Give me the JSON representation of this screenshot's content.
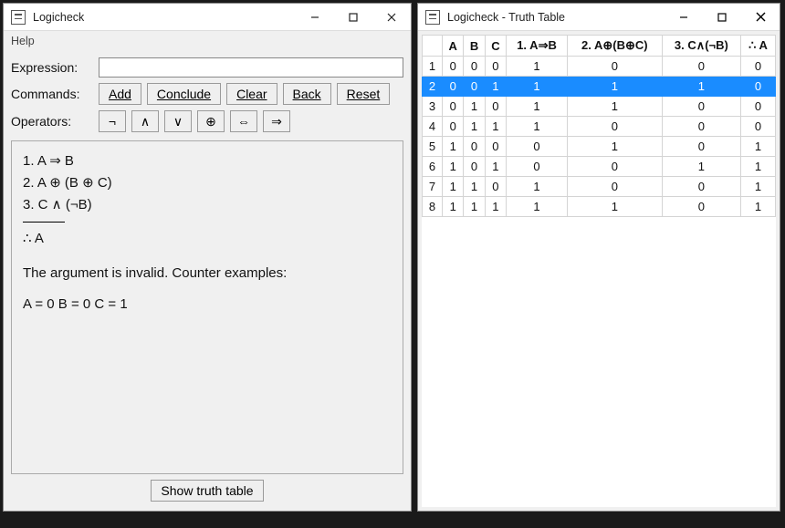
{
  "leftWindow": {
    "title": "Logicheck",
    "menu": {
      "help": "Help"
    },
    "labels": {
      "expression": "Expression:",
      "commands": "Commands:",
      "operators": "Operators:"
    },
    "expressionValue": "",
    "commands": {
      "add": "Add",
      "conclude": "Conclude",
      "clear": "Clear",
      "back": "Back",
      "reset": "Reset"
    },
    "operators": {
      "not": "¬",
      "and": "∧",
      "or": "∨",
      "xor": "⊕",
      "iff": "⇔",
      "implies": "⇒"
    },
    "output": {
      "line1": "1. A ⇒ B",
      "line2": "2. A ⊕ (B ⊕ C)",
      "line3": "3. C ∧ (¬B)",
      "therefore": "∴  A",
      "verdict": "The argument is invalid. Counter examples:",
      "counter": "A = 0  B = 0  C = 1"
    },
    "showTruthTable": "Show truth table"
  },
  "rightWindow": {
    "title": "Logicheck - Truth Table",
    "table": {
      "headers": [
        "A",
        "B",
        "C",
        "1.  A⇒B",
        "2.  A⊕(B⊕C)",
        "3.  C∧(¬B)",
        "∴  A"
      ],
      "rows": [
        {
          "n": 1,
          "cells": [
            "0",
            "0",
            "0",
            "1",
            "0",
            "0",
            "0"
          ],
          "selected": false
        },
        {
          "n": 2,
          "cells": [
            "0",
            "0",
            "1",
            "1",
            "1",
            "1",
            "0"
          ],
          "selected": true
        },
        {
          "n": 3,
          "cells": [
            "0",
            "1",
            "0",
            "1",
            "1",
            "0",
            "0"
          ],
          "selected": false
        },
        {
          "n": 4,
          "cells": [
            "0",
            "1",
            "1",
            "1",
            "0",
            "0",
            "0"
          ],
          "selected": false
        },
        {
          "n": 5,
          "cells": [
            "1",
            "0",
            "0",
            "0",
            "1",
            "0",
            "1"
          ],
          "selected": false
        },
        {
          "n": 6,
          "cells": [
            "1",
            "0",
            "1",
            "0",
            "0",
            "1",
            "1"
          ],
          "selected": false
        },
        {
          "n": 7,
          "cells": [
            "1",
            "1",
            "0",
            "1",
            "0",
            "0",
            "1"
          ],
          "selected": false
        },
        {
          "n": 8,
          "cells": [
            "1",
            "1",
            "1",
            "1",
            "1",
            "0",
            "1"
          ],
          "selected": false
        }
      ]
    }
  }
}
